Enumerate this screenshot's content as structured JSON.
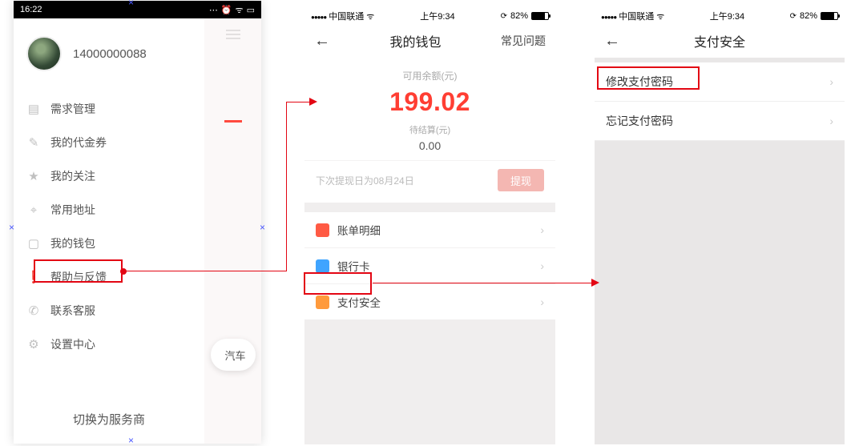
{
  "screen1": {
    "status_time": "16:22",
    "phone_number": "14000000088",
    "menu": [
      {
        "icon": "list-icon",
        "glyph": "▤",
        "label": "需求管理"
      },
      {
        "icon": "ticket-icon",
        "glyph": "✎",
        "label": "我的代金券"
      },
      {
        "icon": "star-icon",
        "glyph": "★",
        "label": "我的关注"
      },
      {
        "icon": "pin-icon",
        "glyph": "⌖",
        "label": "常用地址"
      },
      {
        "icon": "wallet-icon",
        "glyph": "▢",
        "label": "我的钱包"
      },
      {
        "icon": "help-icon",
        "glyph": "❗",
        "label": "帮助与反馈"
      },
      {
        "icon": "phone-icon",
        "glyph": "✆",
        "label": "联系客服"
      },
      {
        "icon": "gear-icon",
        "glyph": "⚙",
        "label": "设置中心"
      }
    ],
    "switch_label": "切换为服务商",
    "pill_label": "汽车"
  },
  "ios_status": {
    "carrier": "中国联通",
    "time": "上午9:34",
    "battery_pct": "82%"
  },
  "screen2": {
    "nav_title": "我的钱包",
    "nav_faq": "常见问题",
    "balance_label": "可用余额(元)",
    "balance_amount": "199.02",
    "pending_label": "待结算(元)",
    "pending_amount": "0.00",
    "withdraw_hint": "下次提现日为08月24日",
    "withdraw_btn": "提现",
    "rows": [
      {
        "icon": "bill-icon",
        "color": "#ff5a44",
        "label": "账单明细"
      },
      {
        "icon": "card-icon",
        "color": "#3fa4ff",
        "label": "银行卡"
      },
      {
        "icon": "key-icon",
        "color": "#ff9a3c",
        "label": "支付安全"
      }
    ]
  },
  "screen3": {
    "nav_title": "支付安全",
    "rows": [
      {
        "label": "修改支付密码"
      },
      {
        "label": "忘记支付密码"
      }
    ]
  }
}
